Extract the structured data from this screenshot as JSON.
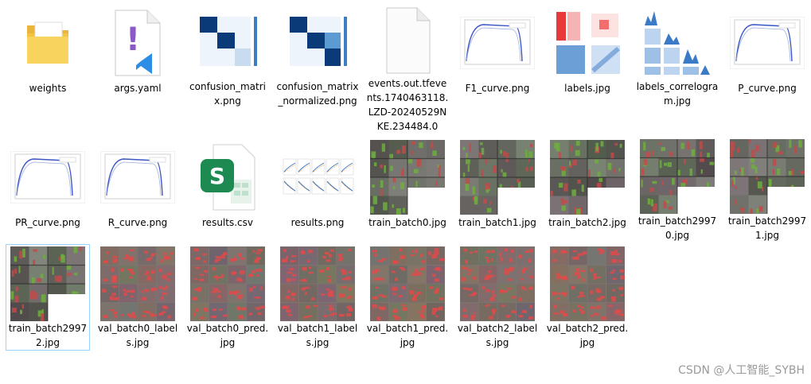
{
  "files": [
    {
      "name": "weights",
      "icon": "folder-icon"
    },
    {
      "name": "args.yaml",
      "icon": "vscode-file-icon"
    },
    {
      "name": "confusion_matrix.png",
      "icon": "confusion-matrix-thumb"
    },
    {
      "name": "confusion_matrix_normalized.png",
      "icon": "confusion-matrix-normalized-thumb"
    },
    {
      "name": "events.out.tfevents.1740463118.LZD-20240529NKE.234484.0",
      "icon": "blank-file-icon"
    },
    {
      "name": "F1_curve.png",
      "icon": "curve-thumb"
    },
    {
      "name": "labels.jpg",
      "icon": "labels-thumb"
    },
    {
      "name": "labels_correlogram.jpg",
      "icon": "correlogram-thumb"
    },
    {
      "name": "P_curve.png",
      "icon": "curve-thumb"
    },
    {
      "name": "PR_curve.png",
      "icon": "curve-thumb"
    },
    {
      "name": "R_curve.png",
      "icon": "curve-thumb"
    },
    {
      "name": "results.csv",
      "icon": "spreadsheet-file-icon"
    },
    {
      "name": "results.png",
      "icon": "results-thumb"
    },
    {
      "name": "train_batch0.jpg",
      "icon": "photo-mosaic-thumb"
    },
    {
      "name": "train_batch1.jpg",
      "icon": "photo-mosaic-thumb"
    },
    {
      "name": "train_batch2.jpg",
      "icon": "photo-mosaic-thumb"
    },
    {
      "name": "train_batch29970.jpg",
      "icon": "photo-mosaic-thumb"
    },
    {
      "name": "train_batch29971.jpg",
      "icon": "photo-mosaic-thumb"
    },
    {
      "name": "train_batch29972.jpg",
      "icon": "photo-mosaic-thumb"
    },
    {
      "name": "val_batch0_labels.jpg",
      "icon": "val-grid-thumb"
    },
    {
      "name": "val_batch0_pred.jpg",
      "icon": "val-grid-thumb"
    },
    {
      "name": "val_batch1_labels.jpg",
      "icon": "val-grid-thumb"
    },
    {
      "name": "val_batch1_pred.jpg",
      "icon": "val-grid-thumb"
    },
    {
      "name": "val_batch2_labels.jpg",
      "icon": "val-grid-thumb"
    },
    {
      "name": "val_batch2_pred.jpg",
      "icon": "val-grid-thumb"
    }
  ],
  "selected_file": "train_batch29972.jpg",
  "watermark": "CSDN @人工智能_SYBH",
  "colors": {
    "selection_border": "#99d1ff",
    "folder": "#f5c342",
    "vscode_blue": "#2b8de6",
    "yaml_purple": "#8a58c7",
    "excel_green": "#1d8a52"
  }
}
